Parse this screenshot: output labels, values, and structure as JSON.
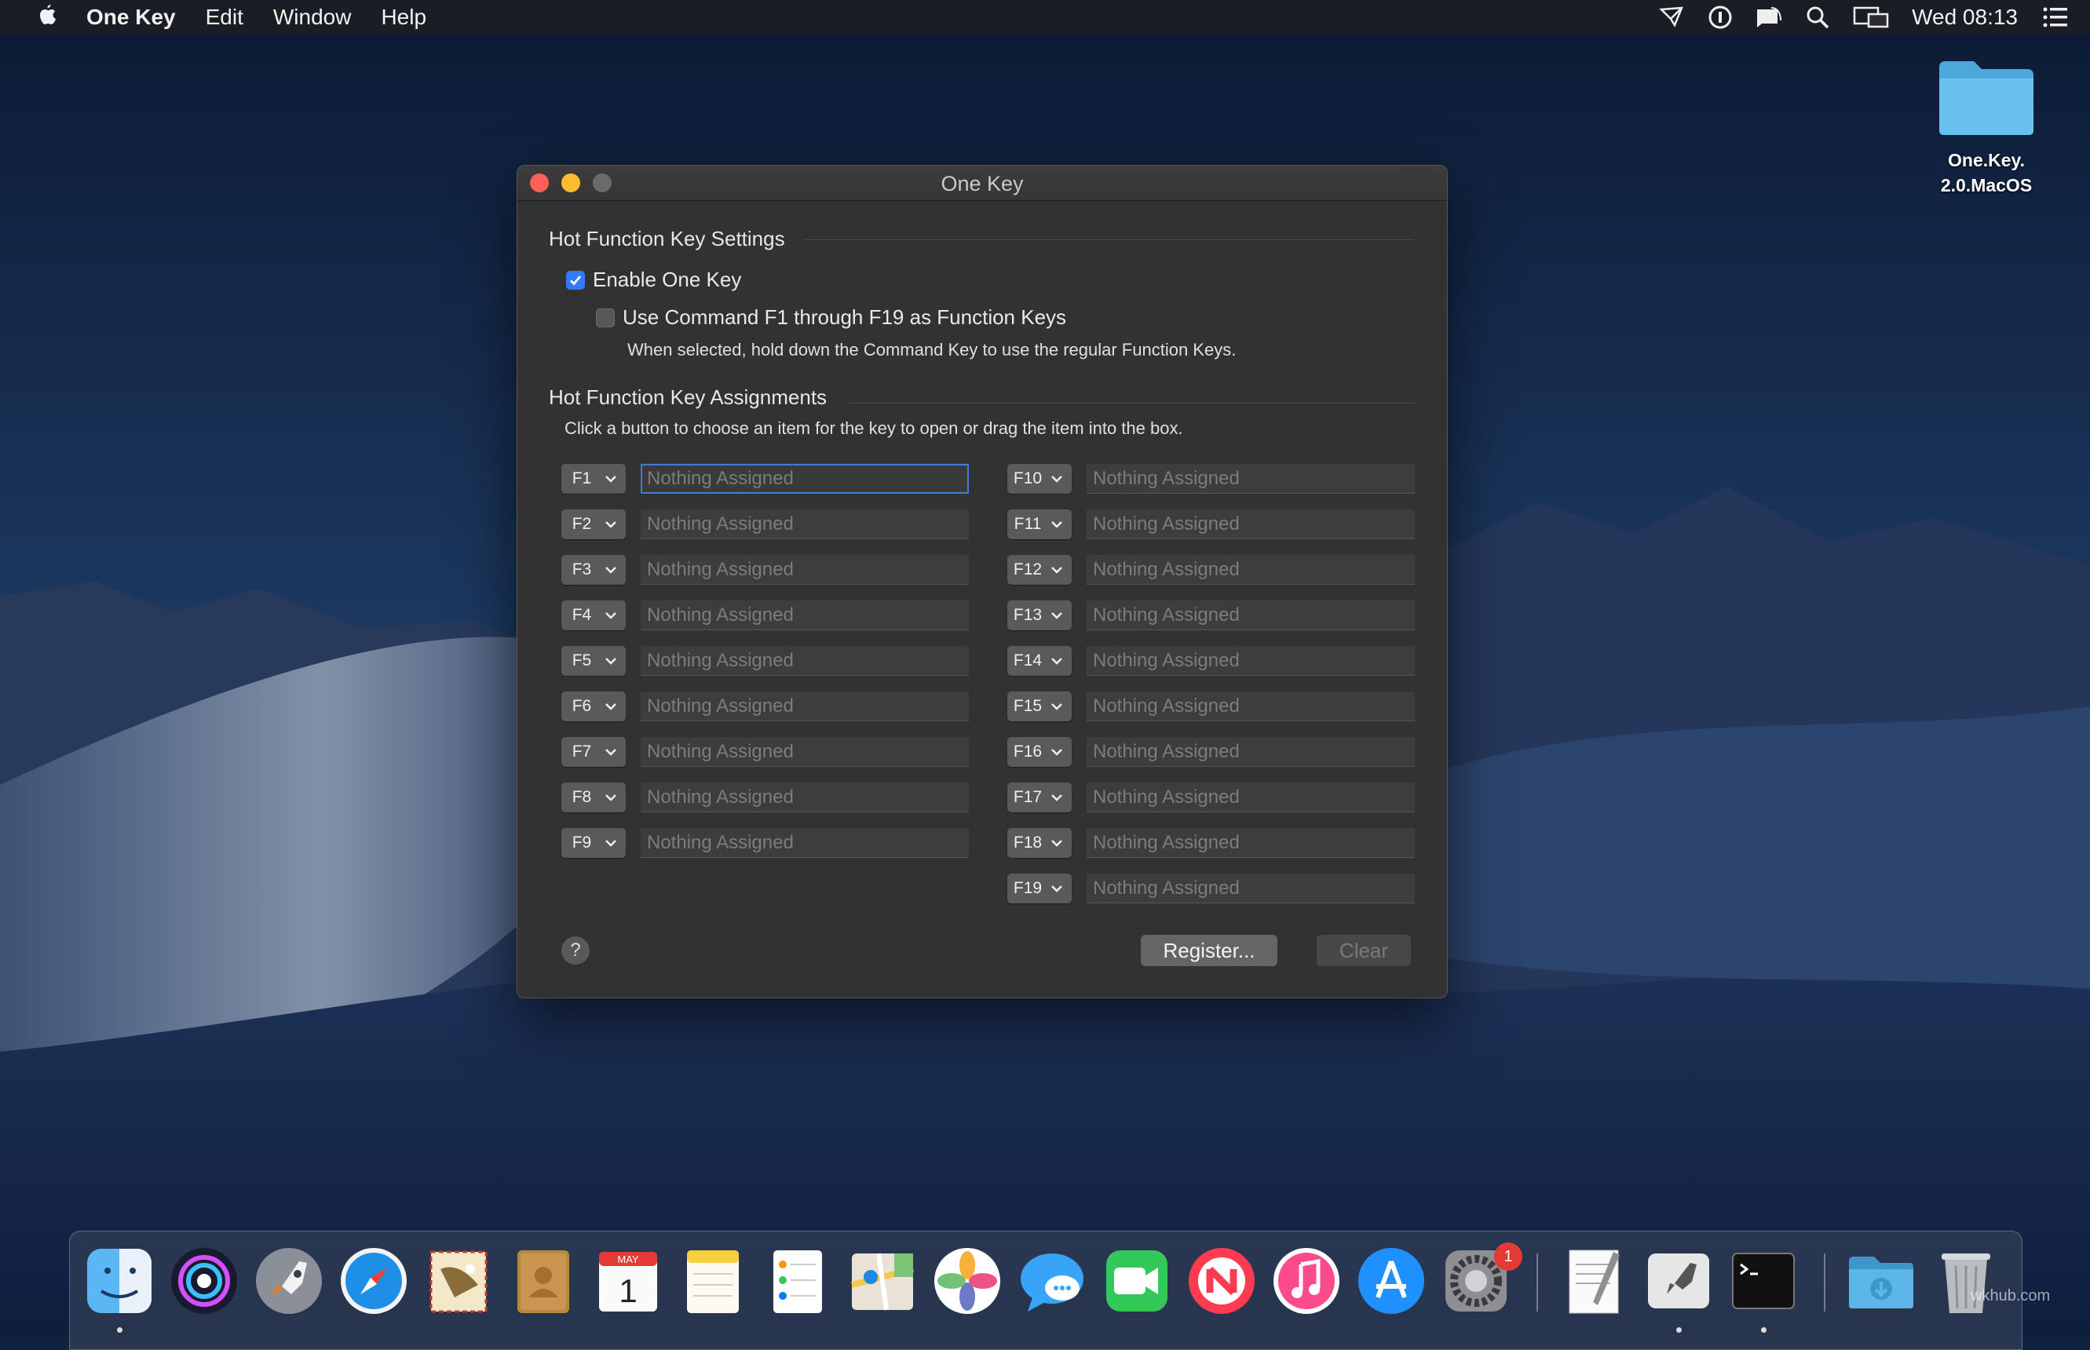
{
  "menubar": {
    "app_name": "One Key",
    "menus": [
      "Edit",
      "Window",
      "Help"
    ],
    "clock": "Wed 08:13",
    "status_icons": [
      "send-icon",
      "1password-icon",
      "notification-icon",
      "spotlight-search-icon",
      "display-mirroring-icon",
      "notification-center-icon"
    ]
  },
  "desktop": {
    "folder_label_line1": "One.Key.",
    "folder_label_line2": "2.0.MacOS"
  },
  "window": {
    "title": "One Key",
    "settings_header": "Hot Function Key Settings",
    "enable_label": "Enable One Key",
    "enable_checked": true,
    "command_label": "Use Command F1 through F19 as Function Keys",
    "command_checked": false,
    "command_hint": "When selected, hold down the Command Key to use the regular Function Keys.",
    "assignments_header": "Hot Function Key Assignments",
    "assignments_hint": "Click a button to choose an item for the key to open or drag the item into the box.",
    "placeholder": "Nothing Assigned",
    "keys_left": [
      "F1",
      "F2",
      "F3",
      "F4",
      "F5",
      "F6",
      "F7",
      "F8",
      "F9"
    ],
    "keys_right": [
      "F10",
      "F11",
      "F12",
      "F13",
      "F14",
      "F15",
      "F16",
      "F17",
      "F18",
      "F19"
    ],
    "help_label": "?",
    "register_label": "Register...",
    "clear_label": "Clear"
  },
  "dock": {
    "apps": [
      "finder-icon",
      "siri-icon",
      "launchpad-icon",
      "safari-icon",
      "mail-icon",
      "contacts-icon",
      "calendar-icon",
      "notes-icon",
      "reminders-icon",
      "maps-icon",
      "photos-icon",
      "messages-icon",
      "facetime-icon",
      "news-icon",
      "music-icon",
      "app-store-icon",
      "system-preferences-icon",
      "textedit-icon",
      "onekey-app-icon",
      "terminal-icon",
      "downloads-folder-icon",
      "trash-icon"
    ],
    "calendar_month": "MAY",
    "calendar_day": "1",
    "prefs_badge": "1"
  },
  "watermark": "wkhub.com"
}
